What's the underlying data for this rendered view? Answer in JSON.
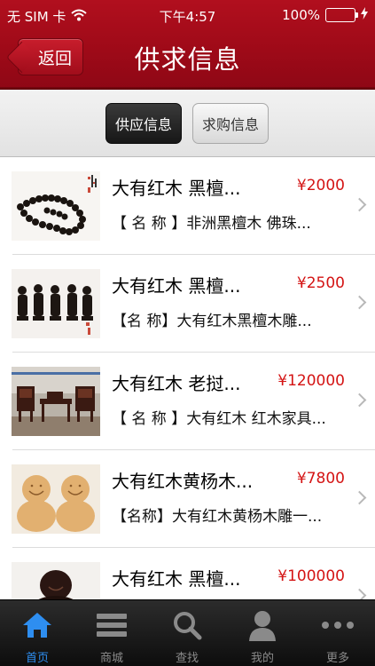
{
  "status_bar": {
    "carrier": "无 SIM 卡",
    "time": "下午4:57",
    "battery": "100%",
    "wifi_icon": "wifi-icon",
    "battery_icon": "battery-icon",
    "charging_icon": "bolt-icon"
  },
  "nav": {
    "back_label": "返回",
    "title": "供求信息"
  },
  "segments": {
    "supply_label": "供应信息",
    "demand_label": "求购信息",
    "selected": "供应信息"
  },
  "items": [
    {
      "title": "大有红木 黑檀...",
      "price": "¥2000",
      "desc": "【 名 称 】非洲黑檀木 佛珠..."
    },
    {
      "title": "大有红木 黑檀...",
      "price": "¥2500",
      "desc": "【名 称】大有红木黑檀木雕..."
    },
    {
      "title": "大有红木 老挝...",
      "price": "¥120000",
      "desc": "【 名 称 】大有红木 红木家具..."
    },
    {
      "title": "大有红木黄杨木...",
      "price": "¥7800",
      "desc": "【名称】大有红木黄杨木雕一..."
    },
    {
      "title": "大有红木 黑檀...",
      "price": "¥100000",
      "desc": ""
    }
  ],
  "tabbar": {
    "tabs": [
      {
        "label": "首页",
        "icon": "home-icon",
        "active": true
      },
      {
        "label": "商城",
        "icon": "list-icon",
        "active": false
      },
      {
        "label": "查找",
        "icon": "search-icon",
        "active": false
      },
      {
        "label": "我的",
        "icon": "user-icon",
        "active": false
      },
      {
        "label": "更多",
        "icon": "more-icon",
        "active": false
      }
    ]
  },
  "colors": {
    "header_red": "#a20b19",
    "price_red": "#d41414",
    "active_tab_blue": "#2e8ef0"
  }
}
